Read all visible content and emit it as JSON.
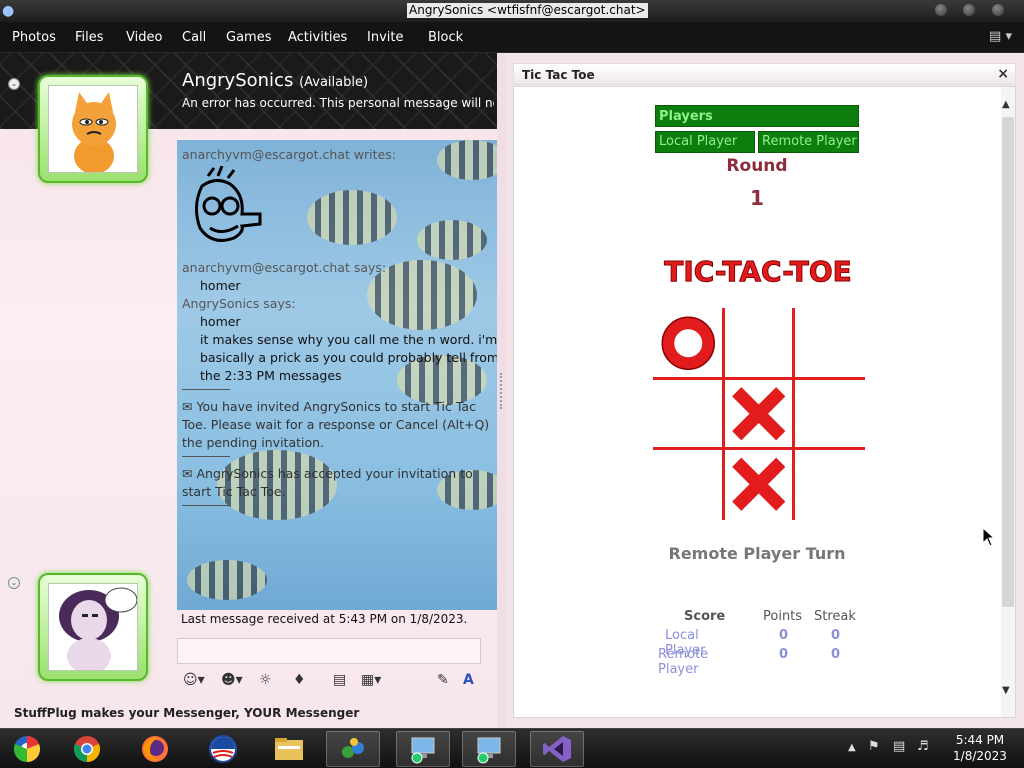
{
  "window": {
    "title": "AngrySonics <wtfisfnf@escargot.chat>"
  },
  "menu": {
    "items": [
      "Photos",
      "Files",
      "Video",
      "Call",
      "Games",
      "Activities",
      "Invite",
      "Block"
    ]
  },
  "contact": {
    "name": "AngrySonics",
    "status": "(Available)",
    "personal_message": "An error has occurred. This personal message will not…"
  },
  "chat": {
    "ink_header": "anarchyvm@escargot.chat writes:",
    "line1_sender": "anarchyvm@escargot.chat says:",
    "line1_msg": "homer",
    "line2_sender": "AngrySonics says:",
    "line2_msg1": "homer",
    "line2_msg2": "it makes sense why you call me the n word. i'm basically a prick as you could probably tell from the 2:33 PM messages",
    "sys1": "You have invited AngrySonics to start Tic Tac Toe. Please wait for a response or Cancel (Alt+Q) the pending invitation.",
    "sys2": "AngrySonics has accepted your invitation to start Tic Tac Toe."
  },
  "last_message": "Last message received at 5:43 PM on 1/8/2023.",
  "statusbar": "StuffPlug makes your Messenger, YOUR Messenger",
  "activity": {
    "title": "Tic Tac Toe",
    "players_label": "Players",
    "local_player": "Local Player",
    "remote_player": "Remote Player",
    "round_label": "Round",
    "round_number": "1",
    "logo_text": "TIC-TAC-TOE",
    "board": [
      "O",
      "",
      "",
      "",
      "X",
      "",
      "",
      "X",
      ""
    ],
    "turn_text": "Remote Player Turn",
    "score": {
      "headers": [
        "Score",
        "Points",
        "Streak"
      ],
      "rows": [
        {
          "name": "Local Player",
          "points": "0",
          "streak": "0"
        },
        {
          "name": "Remote Player",
          "points": "0",
          "streak": "0"
        }
      ]
    },
    "colors": {
      "green": "#0d7d0d",
      "red": "#e02020",
      "maroon": "#8b2d3b"
    }
  },
  "taskbar": {
    "apps": [
      "chrome-icon",
      "chrome-icon",
      "firefox-icon",
      "obama-logo-icon",
      "file-manager-icon",
      "network-icon",
      "computer-icon",
      "computer-icon",
      "visual-studio-icon"
    ],
    "time": "5:44 PM",
    "date": "1/8/2023"
  }
}
